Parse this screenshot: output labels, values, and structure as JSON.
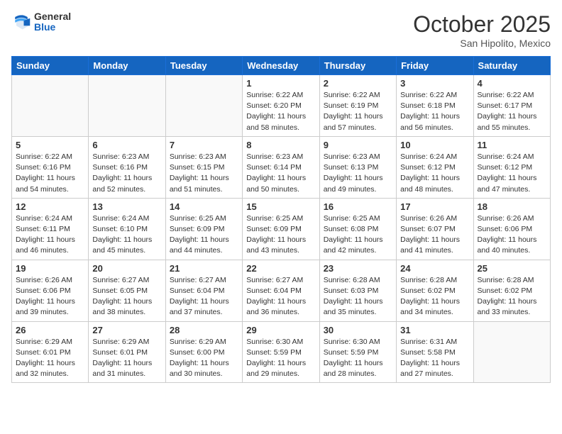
{
  "header": {
    "logo_general": "General",
    "logo_blue": "Blue",
    "month_title": "October 2025",
    "location": "San Hipolito, Mexico"
  },
  "days_of_week": [
    "Sunday",
    "Monday",
    "Tuesday",
    "Wednesday",
    "Thursday",
    "Friday",
    "Saturday"
  ],
  "weeks": [
    [
      {
        "day": "",
        "info": ""
      },
      {
        "day": "",
        "info": ""
      },
      {
        "day": "",
        "info": ""
      },
      {
        "day": "1",
        "info": "Sunrise: 6:22 AM\nSunset: 6:20 PM\nDaylight: 11 hours\nand 58 minutes."
      },
      {
        "day": "2",
        "info": "Sunrise: 6:22 AM\nSunset: 6:19 PM\nDaylight: 11 hours\nand 57 minutes."
      },
      {
        "day": "3",
        "info": "Sunrise: 6:22 AM\nSunset: 6:18 PM\nDaylight: 11 hours\nand 56 minutes."
      },
      {
        "day": "4",
        "info": "Sunrise: 6:22 AM\nSunset: 6:17 PM\nDaylight: 11 hours\nand 55 minutes."
      }
    ],
    [
      {
        "day": "5",
        "info": "Sunrise: 6:22 AM\nSunset: 6:16 PM\nDaylight: 11 hours\nand 54 minutes."
      },
      {
        "day": "6",
        "info": "Sunrise: 6:23 AM\nSunset: 6:16 PM\nDaylight: 11 hours\nand 52 minutes."
      },
      {
        "day": "7",
        "info": "Sunrise: 6:23 AM\nSunset: 6:15 PM\nDaylight: 11 hours\nand 51 minutes."
      },
      {
        "day": "8",
        "info": "Sunrise: 6:23 AM\nSunset: 6:14 PM\nDaylight: 11 hours\nand 50 minutes."
      },
      {
        "day": "9",
        "info": "Sunrise: 6:23 AM\nSunset: 6:13 PM\nDaylight: 11 hours\nand 49 minutes."
      },
      {
        "day": "10",
        "info": "Sunrise: 6:24 AM\nSunset: 6:12 PM\nDaylight: 11 hours\nand 48 minutes."
      },
      {
        "day": "11",
        "info": "Sunrise: 6:24 AM\nSunset: 6:12 PM\nDaylight: 11 hours\nand 47 minutes."
      }
    ],
    [
      {
        "day": "12",
        "info": "Sunrise: 6:24 AM\nSunset: 6:11 PM\nDaylight: 11 hours\nand 46 minutes."
      },
      {
        "day": "13",
        "info": "Sunrise: 6:24 AM\nSunset: 6:10 PM\nDaylight: 11 hours\nand 45 minutes."
      },
      {
        "day": "14",
        "info": "Sunrise: 6:25 AM\nSunset: 6:09 PM\nDaylight: 11 hours\nand 44 minutes."
      },
      {
        "day": "15",
        "info": "Sunrise: 6:25 AM\nSunset: 6:09 PM\nDaylight: 11 hours\nand 43 minutes."
      },
      {
        "day": "16",
        "info": "Sunrise: 6:25 AM\nSunset: 6:08 PM\nDaylight: 11 hours\nand 42 minutes."
      },
      {
        "day": "17",
        "info": "Sunrise: 6:26 AM\nSunset: 6:07 PM\nDaylight: 11 hours\nand 41 minutes."
      },
      {
        "day": "18",
        "info": "Sunrise: 6:26 AM\nSunset: 6:06 PM\nDaylight: 11 hours\nand 40 minutes."
      }
    ],
    [
      {
        "day": "19",
        "info": "Sunrise: 6:26 AM\nSunset: 6:06 PM\nDaylight: 11 hours\nand 39 minutes."
      },
      {
        "day": "20",
        "info": "Sunrise: 6:27 AM\nSunset: 6:05 PM\nDaylight: 11 hours\nand 38 minutes."
      },
      {
        "day": "21",
        "info": "Sunrise: 6:27 AM\nSunset: 6:04 PM\nDaylight: 11 hours\nand 37 minutes."
      },
      {
        "day": "22",
        "info": "Sunrise: 6:27 AM\nSunset: 6:04 PM\nDaylight: 11 hours\nand 36 minutes."
      },
      {
        "day": "23",
        "info": "Sunrise: 6:28 AM\nSunset: 6:03 PM\nDaylight: 11 hours\nand 35 minutes."
      },
      {
        "day": "24",
        "info": "Sunrise: 6:28 AM\nSunset: 6:02 PM\nDaylight: 11 hours\nand 34 minutes."
      },
      {
        "day": "25",
        "info": "Sunrise: 6:28 AM\nSunset: 6:02 PM\nDaylight: 11 hours\nand 33 minutes."
      }
    ],
    [
      {
        "day": "26",
        "info": "Sunrise: 6:29 AM\nSunset: 6:01 PM\nDaylight: 11 hours\nand 32 minutes."
      },
      {
        "day": "27",
        "info": "Sunrise: 6:29 AM\nSunset: 6:01 PM\nDaylight: 11 hours\nand 31 minutes."
      },
      {
        "day": "28",
        "info": "Sunrise: 6:29 AM\nSunset: 6:00 PM\nDaylight: 11 hours\nand 30 minutes."
      },
      {
        "day": "29",
        "info": "Sunrise: 6:30 AM\nSunset: 5:59 PM\nDaylight: 11 hours\nand 29 minutes."
      },
      {
        "day": "30",
        "info": "Sunrise: 6:30 AM\nSunset: 5:59 PM\nDaylight: 11 hours\nand 28 minutes."
      },
      {
        "day": "31",
        "info": "Sunrise: 6:31 AM\nSunset: 5:58 PM\nDaylight: 11 hours\nand 27 minutes."
      },
      {
        "day": "",
        "info": ""
      }
    ]
  ]
}
